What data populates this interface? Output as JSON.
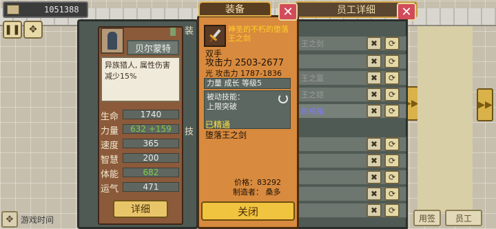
{
  "top": {
    "money": "1051388",
    "right_title": "员工详细"
  },
  "character": {
    "name": "贝尔蒙特",
    "description": "异族猎人, 属性伤害减少15%",
    "stats": [
      {
        "label": "生命",
        "value": "1740",
        "green": false
      },
      {
        "label": "力量",
        "value": "632 +159",
        "green": true
      },
      {
        "label": "速度",
        "value": "365",
        "green": false
      },
      {
        "label": "智慧",
        "value": "200",
        "green": false
      },
      {
        "label": "体能",
        "value": "682",
        "green": true
      },
      {
        "label": "运气",
        "value": "471",
        "green": false
      }
    ],
    "detail_label": "详细",
    "side_tab_equip": "装",
    "side_tab_skill": "技"
  },
  "equipment_list": {
    "rows": [
      {
        "name": "王之剑",
        "purple": false
      },
      {
        "name": "",
        "purple": false
      },
      {
        "name": "王之盔",
        "purple": false
      },
      {
        "name": "王之铠",
        "purple": false
      },
      {
        "name": "的戒指",
        "purple": true
      },
      {
        "name": "",
        "purple": false
      },
      {
        "name": "",
        "purple": false
      },
      {
        "name": "",
        "purple": false
      },
      {
        "name": "",
        "purple": false
      },
      {
        "name": "",
        "purple": false
      }
    ]
  },
  "popup": {
    "tab_label": "装备",
    "item_name": "神圣的不朽的堕落王之剑",
    "hand": "双手",
    "attack": "攻击力 2503-2677",
    "light_attack": "光 攻击力 1787-1836",
    "growth": "力量  成长  等级5",
    "passive_title": "被动技能：",
    "passive_skill": "上限突破",
    "mastered": "已精通",
    "owner_name": "堕落王之剑",
    "price": "价格：83292",
    "maker": "制造者： 桑多",
    "close_label": "关闭"
  },
  "footer": {
    "game_time": "游戏时间",
    "btn_left": "用签",
    "btn_right": "员工"
  }
}
